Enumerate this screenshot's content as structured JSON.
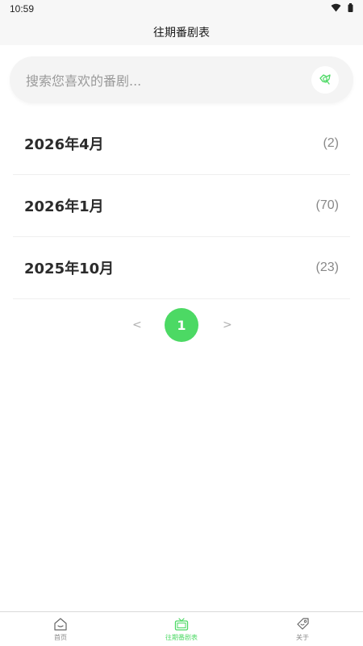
{
  "status_bar": {
    "time": "10:59"
  },
  "header": {
    "title": "往期番剧表"
  },
  "search": {
    "placeholder": "搜索您喜欢的番剧..."
  },
  "seasons": [
    {
      "name": "2026年4月",
      "count": "(2)"
    },
    {
      "name": "2026年1月",
      "count": "(70)"
    },
    {
      "name": "2025年10月",
      "count": "(23)"
    }
  ],
  "pagination": {
    "prev": "<",
    "current": "1",
    "next": ">"
  },
  "tabs": [
    {
      "label": "首页",
      "icon": "home-icon",
      "active": false
    },
    {
      "label": "往期番剧表",
      "icon": "tv-icon",
      "active": true
    },
    {
      "label": "关于",
      "icon": "tag-icon",
      "active": false
    }
  ],
  "colors": {
    "accent": "#4cd964",
    "text": "#2b2b2b",
    "muted": "#888888"
  }
}
